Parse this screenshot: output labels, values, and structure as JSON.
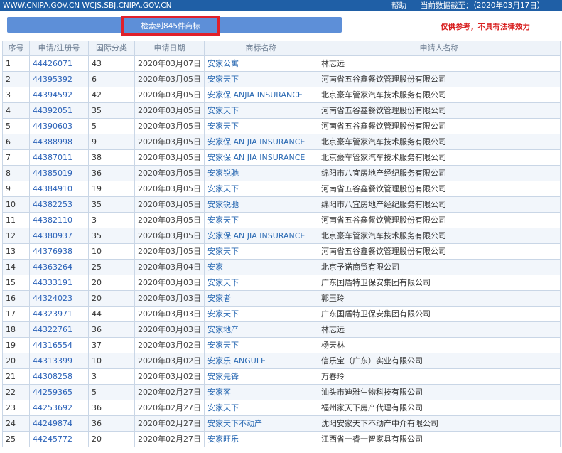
{
  "topbar": {
    "sites": "WWW.CNIPA.GOV.CN WCJS.SBJ.CNIPA.GOV.CN",
    "help": "帮助",
    "data_date": "当前数据截至：（2020年03月17日）"
  },
  "search": {
    "result_text": "检索到845件商标"
  },
  "disclaimer": "仅供参考，不具有法律效力",
  "columns": [
    "序号",
    "申请/注册号",
    "国际分类",
    "申请日期",
    "商标名称",
    "申请人名称"
  ],
  "rows": [
    {
      "no": "1",
      "reg": "44426071",
      "cls": "43",
      "date": "2020年03月07日",
      "mark": "安家公寓",
      "applicant": "林志远"
    },
    {
      "no": "2",
      "reg": "44395392",
      "cls": "6",
      "date": "2020年03月05日",
      "mark": "安家天下",
      "applicant": "河南省五谷鑫餐饮管理股份有限公司"
    },
    {
      "no": "3",
      "reg": "44394592",
      "cls": "42",
      "date": "2020年03月05日",
      "mark": "安家保 ANJIA INSURANCE",
      "applicant": "北京豪车管家汽车技术服务有限公司"
    },
    {
      "no": "4",
      "reg": "44392051",
      "cls": "35",
      "date": "2020年03月05日",
      "mark": "安家天下",
      "applicant": "河南省五谷鑫餐饮管理股份有限公司"
    },
    {
      "no": "5",
      "reg": "44390603",
      "cls": "5",
      "date": "2020年03月05日",
      "mark": "安家天下",
      "applicant": "河南省五谷鑫餐饮管理股份有限公司"
    },
    {
      "no": "6",
      "reg": "44388998",
      "cls": "9",
      "date": "2020年03月05日",
      "mark": "安家保 AN JIA INSURANCE",
      "applicant": "北京豪车管家汽车技术服务有限公司"
    },
    {
      "no": "7",
      "reg": "44387011",
      "cls": "38",
      "date": "2020年03月05日",
      "mark": "安家保 AN JIA INSURANCE",
      "applicant": "北京豪车管家汽车技术服务有限公司"
    },
    {
      "no": "8",
      "reg": "44385019",
      "cls": "36",
      "date": "2020年03月05日",
      "mark": "安家锐驰",
      "applicant": "绵阳市八宜房地产经纪服务有限公司"
    },
    {
      "no": "9",
      "reg": "44384910",
      "cls": "19",
      "date": "2020年03月05日",
      "mark": "安家天下",
      "applicant": "河南省五谷鑫餐饮管理股份有限公司"
    },
    {
      "no": "10",
      "reg": "44382253",
      "cls": "35",
      "date": "2020年03月05日",
      "mark": "安家锐驰",
      "applicant": "绵阳市八宜房地产经纪服务有限公司"
    },
    {
      "no": "11",
      "reg": "44382110",
      "cls": "3",
      "date": "2020年03月05日",
      "mark": "安家天下",
      "applicant": "河南省五谷鑫餐饮管理股份有限公司"
    },
    {
      "no": "12",
      "reg": "44380937",
      "cls": "35",
      "date": "2020年03月05日",
      "mark": "安家保 AN JIA INSURANCE",
      "applicant": "北京豪车管家汽车技术服务有限公司"
    },
    {
      "no": "13",
      "reg": "44376938",
      "cls": "10",
      "date": "2020年03月05日",
      "mark": "安家天下",
      "applicant": "河南省五谷鑫餐饮管理股份有限公司"
    },
    {
      "no": "14",
      "reg": "44363264",
      "cls": "25",
      "date": "2020年03月04日",
      "mark": "安家",
      "applicant": "北京予诺商贸有限公司"
    },
    {
      "no": "15",
      "reg": "44333191",
      "cls": "20",
      "date": "2020年03月03日",
      "mark": "安家天下",
      "applicant": "广东国盾特卫保安集团有限公司"
    },
    {
      "no": "16",
      "reg": "44324023",
      "cls": "20",
      "date": "2020年03月03日",
      "mark": "安家者",
      "applicant": "郭玉玲"
    },
    {
      "no": "17",
      "reg": "44323971",
      "cls": "44",
      "date": "2020年03月03日",
      "mark": "安家天下",
      "applicant": "广东国盾特卫保安集团有限公司"
    },
    {
      "no": "18",
      "reg": "44322761",
      "cls": "36",
      "date": "2020年03月03日",
      "mark": "安家地产",
      "applicant": "林志远"
    },
    {
      "no": "19",
      "reg": "44316554",
      "cls": "37",
      "date": "2020年03月02日",
      "mark": "安家天下",
      "applicant": "杨天林"
    },
    {
      "no": "20",
      "reg": "44313399",
      "cls": "10",
      "date": "2020年03月02日",
      "mark": "安家乐 ANGULE",
      "applicant": "信乐宝（广东）实业有限公司"
    },
    {
      "no": "21",
      "reg": "44308258",
      "cls": "3",
      "date": "2020年03月02日",
      "mark": "安家先锋",
      "applicant": "万春玲"
    },
    {
      "no": "22",
      "reg": "44259365",
      "cls": "5",
      "date": "2020年02月27日",
      "mark": "安家客",
      "applicant": "汕头市迪雅生物科技有限公司"
    },
    {
      "no": "23",
      "reg": "44253692",
      "cls": "36",
      "date": "2020年02月27日",
      "mark": "安家天下",
      "applicant": "福州家天下房产代理有限公司"
    },
    {
      "no": "24",
      "reg": "44249874",
      "cls": "36",
      "date": "2020年02月27日",
      "mark": "安家天下不动产",
      "applicant": "沈阳安家天下不动产中介有限公司"
    },
    {
      "no": "25",
      "reg": "44245772",
      "cls": "20",
      "date": "2020年02月27日",
      "mark": "安家旺乐",
      "applicant": "江西省一睿一智家具有限公司"
    }
  ]
}
